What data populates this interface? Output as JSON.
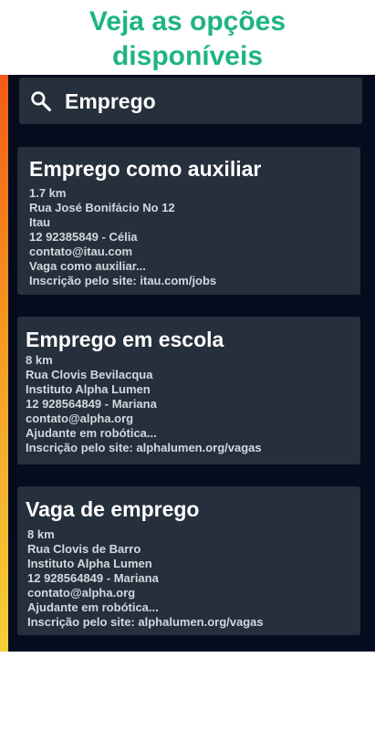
{
  "header": {
    "title_line1": "Veja as opções",
    "title_line2": "disponíveis"
  },
  "search": {
    "icon": "search-icon",
    "value": "Emprego"
  },
  "colors": {
    "title_green": "#1fb482",
    "panel_bg": "#070b1e",
    "card_bg": "#262f3c",
    "accent_top": "#f25c17",
    "accent_bottom": "#f4cf3a"
  },
  "cards": [
    {
      "title": "Emprego como auxiliar",
      "distance": "1.7 km",
      "address": "Rua José Bonifácio No 12",
      "company": "Itau",
      "phone_contact": "12 92385849 - Célia",
      "email": "contato@itau.com",
      "description": "Vaga como auxiliar...",
      "signup": "Inscrição pelo site: itau.com/jobs"
    },
    {
      "title": "Emprego em escola",
      "distance": "8 km",
      "address": "Rua Clovis Bevilacqua",
      "company": "Instituto Alpha Lumen",
      "phone_contact": "12 928564849 - Mariana",
      "email": "contato@alpha.org",
      "description": "Ajudante em robótica...",
      "signup": "Inscrição pelo site: alphalumen.org/vagas"
    },
    {
      "title": "Vaga de emprego",
      "distance": "8 km",
      "address": "Rua Clovis de Barro",
      "company": "Instituto Alpha Lumen",
      "phone_contact": "12 928564849 - Mariana",
      "email": "contato@alpha.org",
      "description": "Ajudante em robótica...",
      "signup": "Inscrição pelo site: alphalumen.org/vagas"
    }
  ]
}
